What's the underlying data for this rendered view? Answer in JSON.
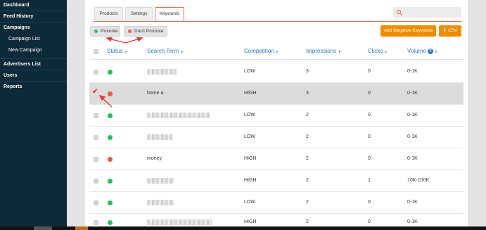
{
  "sidebar": {
    "items": [
      {
        "label": "Dashboard"
      },
      {
        "label": "Feed History"
      },
      {
        "label": "Campaigns"
      },
      {
        "label": "Campaign List"
      },
      {
        "label": "New Campaign"
      },
      {
        "label": "Advertisers List"
      },
      {
        "label": "Users"
      },
      {
        "label": "Reports"
      }
    ]
  },
  "tabs": [
    "Products",
    "Settings",
    "Keywords"
  ],
  "active_tab": "Keywords",
  "search": {
    "placeholder": ""
  },
  "actions": {
    "promote": "Promote",
    "dont_promote": "Don't Promote",
    "add_negative": "Add Negative Keywords",
    "csv": "CSV"
  },
  "table": {
    "headers": [
      "Status",
      "Search Term",
      "Competition",
      "Impressions",
      "Clicks",
      "Volume"
    ],
    "rows": [
      {
        "status": "green",
        "term": "",
        "competition": "LOW",
        "impressions": "3",
        "clicks": "0",
        "volume": "0-1K"
      },
      {
        "status": "red",
        "term": "home a",
        "competition": "HIGH",
        "impressions": "3",
        "clicks": "0",
        "volume": "0-1K",
        "checked": true
      },
      {
        "status": "green",
        "term": "",
        "competition": "LOW",
        "impressions": "2",
        "clicks": "0",
        "volume": "0-1K"
      },
      {
        "status": "green",
        "term": "",
        "competition": "LOW",
        "impressions": "2",
        "clicks": "0",
        "volume": "0-1K"
      },
      {
        "status": "red",
        "term": "money",
        "competition": "HIGH",
        "impressions": "2",
        "clicks": "0",
        "volume": "0-1K"
      },
      {
        "status": "green",
        "term": "",
        "competition": "HIGH",
        "impressions": "2",
        "clicks": "1",
        "volume": "10K-100K"
      },
      {
        "status": "green",
        "term": "",
        "competition": "LOW",
        "impressions": "2",
        "clicks": "0",
        "volume": "0-1K"
      },
      {
        "status": "green",
        "term": "",
        "competition": "HIGH",
        "impressions": "2",
        "clicks": "0",
        "volume": "0-1K"
      }
    ]
  },
  "colors": {
    "green": "#1ec45a",
    "red": "#f05a3a",
    "accent": "#f08c00",
    "link": "#2a7ac8"
  }
}
